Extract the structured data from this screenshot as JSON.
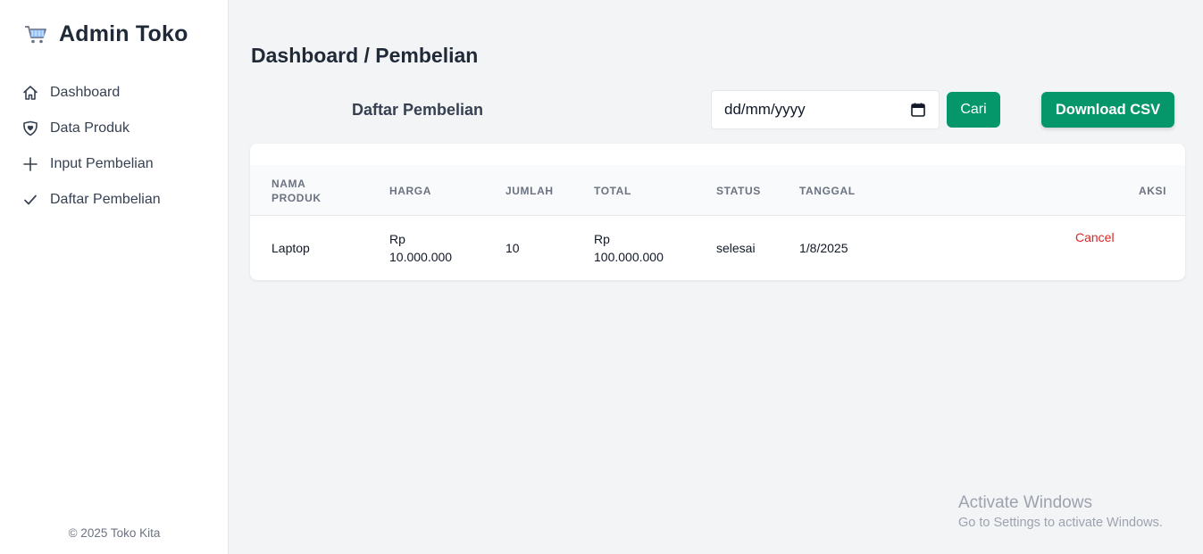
{
  "sidebar": {
    "brand_icon": "shopping-cart-icon",
    "brand_title": "Admin Toko",
    "items": [
      {
        "label": "Dashboard",
        "icon": "home-icon"
      },
      {
        "label": "Data Produk",
        "icon": "shield-heart-icon"
      },
      {
        "label": "Input Pembelian",
        "icon": "plus-icon"
      },
      {
        "label": "Daftar Pembelian",
        "icon": "check-icon"
      }
    ],
    "footer": "© 2025 Toko Kita"
  },
  "main": {
    "page_title": "Dashboard / Pembelian",
    "section_label": "Daftar Pembelian",
    "date_input": {
      "value": "dd/mm/yyyy",
      "icon": "calendar-icon"
    },
    "search_button": "Cari",
    "download_button": "Download CSV",
    "accent_color": "#059669"
  },
  "table": {
    "headers": {
      "nama_produk_1": "NAMA",
      "nama_produk_2": "PRODUK",
      "harga": "HARGA",
      "jumlah": "JUMLAH",
      "total": "TOTAL",
      "status": "STATUS",
      "tanggal": "TANGGAL",
      "aksi": "AKSI"
    },
    "rows": [
      {
        "nama_produk": "Laptop",
        "harga_1": "Rp",
        "harga_2": "10.000.000",
        "jumlah": "10",
        "total_1": "Rp",
        "total_2": "100.000.000",
        "status": "selesai",
        "tanggal": "1/8/2025",
        "aksi": "Cancel"
      }
    ]
  },
  "watermark": {
    "line1": "Activate Windows",
    "line2": "Go to Settings to activate Windows."
  }
}
